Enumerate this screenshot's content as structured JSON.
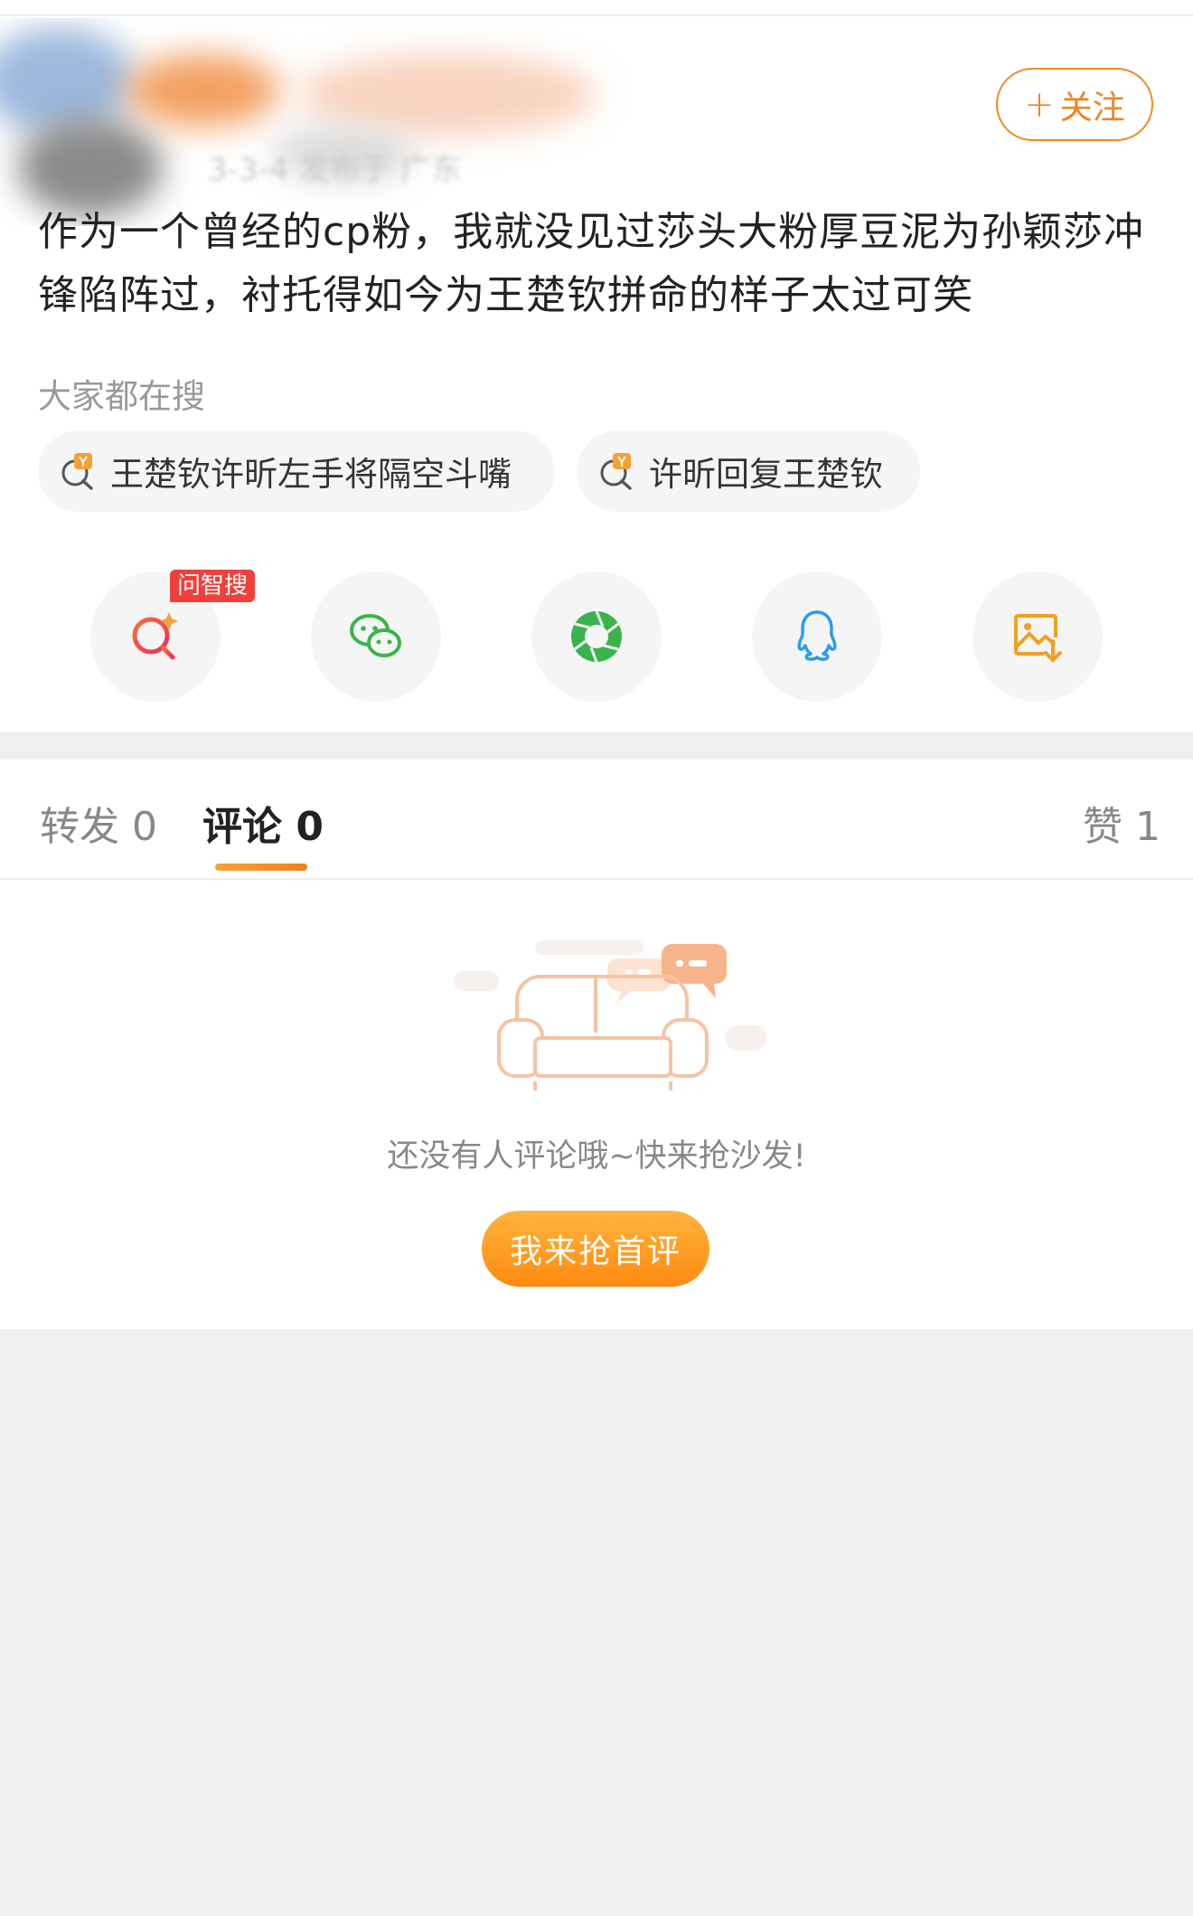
{
  "header": {
    "meta_text": "3-3-4  发布于 广东",
    "follow_label": "关注",
    "follow_plus": "+"
  },
  "post": {
    "text": "作为一个曾经的cp粉，我就没见过莎头大粉厚豆泥为孙颖莎冲锋陷阵过，衬托得如今为王楚钦拼命的样子太过可笑"
  },
  "hot_search": {
    "title": "大家都在搜",
    "chips": [
      {
        "label": "王楚钦许昕左手将隔空斗嘴",
        "icon": "hot-search-icon"
      },
      {
        "label": "许昕回复王楚钦",
        "icon": "hot-search-icon"
      }
    ]
  },
  "share": {
    "ai_badge": "问智搜",
    "buttons": [
      {
        "name": "ai-search",
        "icon": "ai-search-icon",
        "color": "#f05a5a"
      },
      {
        "name": "wechat",
        "icon": "wechat-icon",
        "color": "#3ab44a"
      },
      {
        "name": "moments",
        "icon": "moments-icon",
        "color": "#3ab44a"
      },
      {
        "name": "qq",
        "icon": "qq-icon",
        "color": "#2a9cf0"
      },
      {
        "name": "save-image",
        "icon": "save-image-icon",
        "color": "#f0a020"
      }
    ]
  },
  "tabs": {
    "repost": "转发 0",
    "comments": "评论 0",
    "likes": "赞 1",
    "active": "comments"
  },
  "empty_state": {
    "message": "还没有人评论哦~快来抢沙发!",
    "cta": "我来抢首评"
  },
  "colors": {
    "accent": "#f08a24",
    "badge": "#f1403b",
    "background": "#efefef"
  }
}
